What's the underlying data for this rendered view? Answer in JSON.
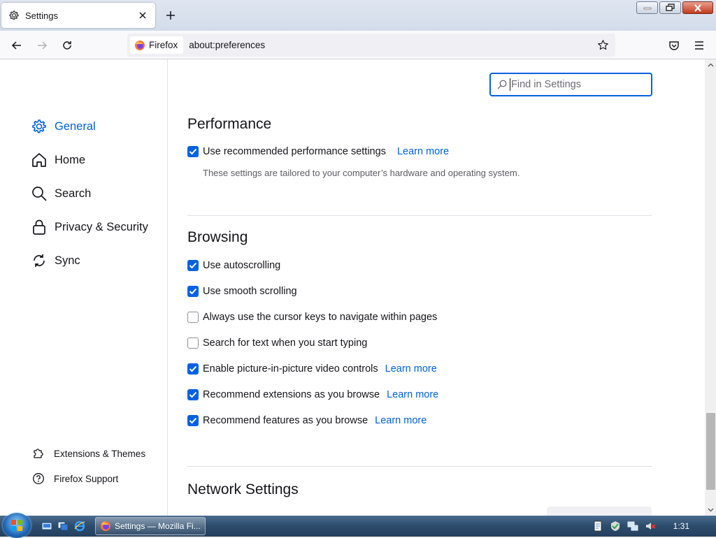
{
  "tab": {
    "title": "Settings"
  },
  "urlbar": {
    "identity_label": "Firefox",
    "url": "about:preferences"
  },
  "sidebar": {
    "categories": [
      {
        "label": "General",
        "icon": "gear-icon",
        "selected": true
      },
      {
        "label": "Home",
        "icon": "home-icon"
      },
      {
        "label": "Search",
        "icon": "search-icon"
      },
      {
        "label": "Privacy & Security",
        "icon": "lock-icon"
      },
      {
        "label": "Sync",
        "icon": "sync-icon"
      }
    ],
    "footer": [
      {
        "label": "Extensions & Themes",
        "icon": "puzzle-icon"
      },
      {
        "label": "Firefox Support",
        "icon": "help-icon"
      }
    ]
  },
  "search": {
    "placeholder": "Find in Settings"
  },
  "performance": {
    "heading": "Performance",
    "recommended": {
      "label": "Use recommended performance settings",
      "checked": true,
      "learn_more": "Learn more"
    },
    "description": "These settings are tailored to your computer’s hardware and operating system."
  },
  "browsing": {
    "heading": "Browsing",
    "options": [
      {
        "label": "Use autoscrolling",
        "checked": true
      },
      {
        "label": "Use smooth scrolling",
        "checked": true
      },
      {
        "label": "Always use the cursor keys to navigate within pages",
        "checked": false
      },
      {
        "label": "Search for text when you start typing",
        "checked": false
      },
      {
        "label": "Enable picture-in-picture video controls",
        "checked": true,
        "learn_more": "Learn more"
      },
      {
        "label": "Recommend extensions as you browse",
        "checked": true,
        "learn_more": "Learn more"
      },
      {
        "label": "Recommend features as you browse",
        "checked": true,
        "learn_more": "Learn more"
      }
    ]
  },
  "network": {
    "heading": "Network Settings"
  },
  "taskbar": {
    "task_label": "Settings — Mozilla Fi...",
    "clock": "1:31"
  },
  "colors": {
    "accent": "#0061e0",
    "text": "#15141a",
    "muted": "#5b5b66"
  }
}
